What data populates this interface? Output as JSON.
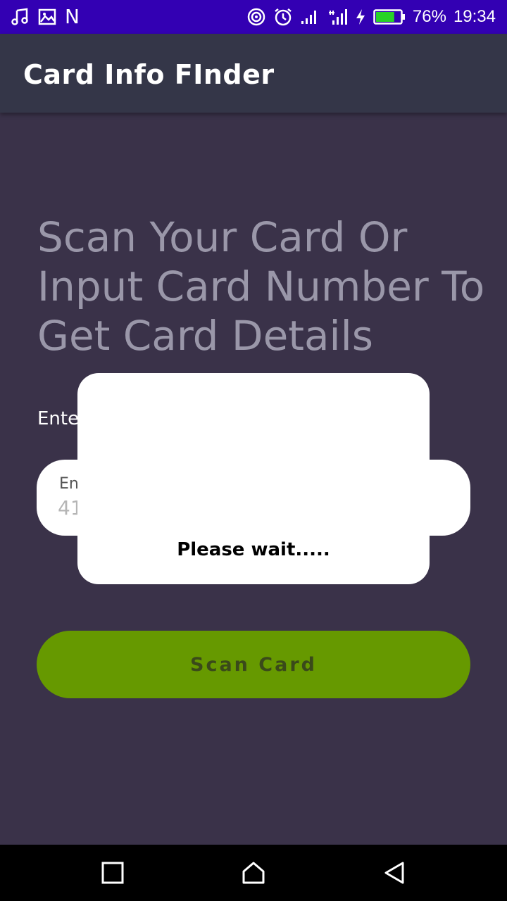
{
  "status_bar": {
    "left_icons": [
      "music-icon",
      "image-icon",
      "notification-n-icon"
    ],
    "notification_letter": "N",
    "right_icons": [
      "hotspot-icon",
      "alarm-icon",
      "signal-icon",
      "signal-data-icon",
      "charging-icon",
      "battery-icon"
    ],
    "battery_percent": "76%",
    "battery_level": 0.76,
    "time": "19:34",
    "color": "#3300b3"
  },
  "app_bar": {
    "title": "Card Info FInder",
    "color": "#343648"
  },
  "main": {
    "headline": "Scan Your Card Or Input Card Number To Get Card Details",
    "field_label": "Enter",
    "card_input": {
      "label": "En",
      "placeholder": "41"
    },
    "scan_button": {
      "label": "Scan Card",
      "color": "#669900"
    },
    "background": "#3a3249"
  },
  "dialog": {
    "message": "Please wait....."
  },
  "nav_bar": {
    "buttons": [
      "recents-square-icon",
      "home-icon",
      "back-triangle-icon"
    ]
  }
}
